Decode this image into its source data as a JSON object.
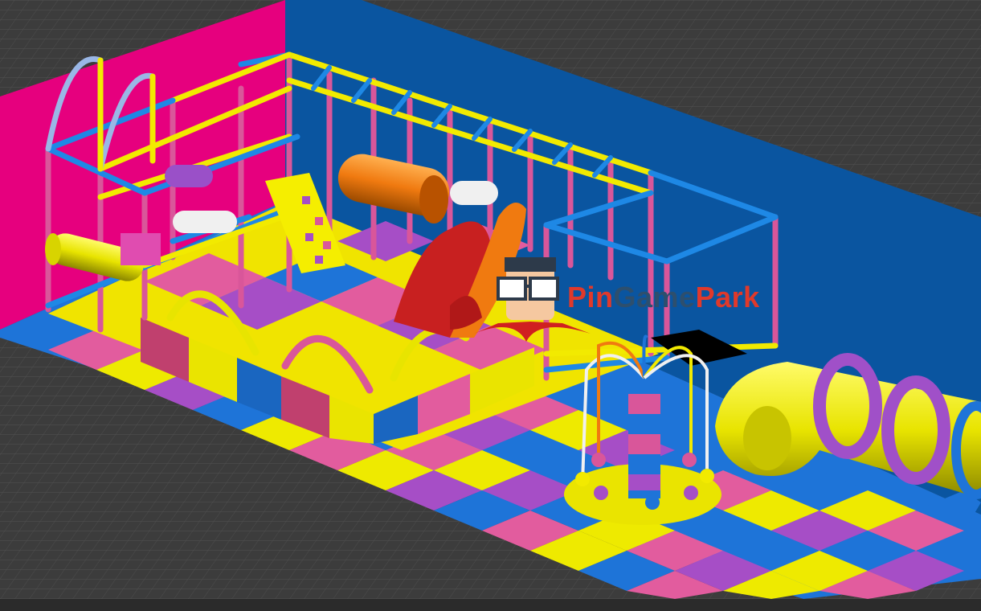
{
  "watermark": {
    "part1": "Pin",
    "part2": "Game",
    "part3": "Park"
  },
  "colors": {
    "background": "#3a3a3a",
    "wall_left": "#e6007e",
    "wall_back": "#0a55a0",
    "frame_pink": "#d9569a",
    "frame_blue": "#1e88e5",
    "frame_yellow": "#f2ea00",
    "floor_pink": "#e25c9e",
    "floor_yellow": "#eeea00",
    "floor_blue": "#1e74d8",
    "floor_purple": "#a64ec6",
    "slide_orange": "#f07a10",
    "slide_red": "#c82020",
    "tunnel_yellow": "#e8e400",
    "ring_purple": "#a050c8"
  },
  "icons": [
    "mascot-logo-icon"
  ]
}
